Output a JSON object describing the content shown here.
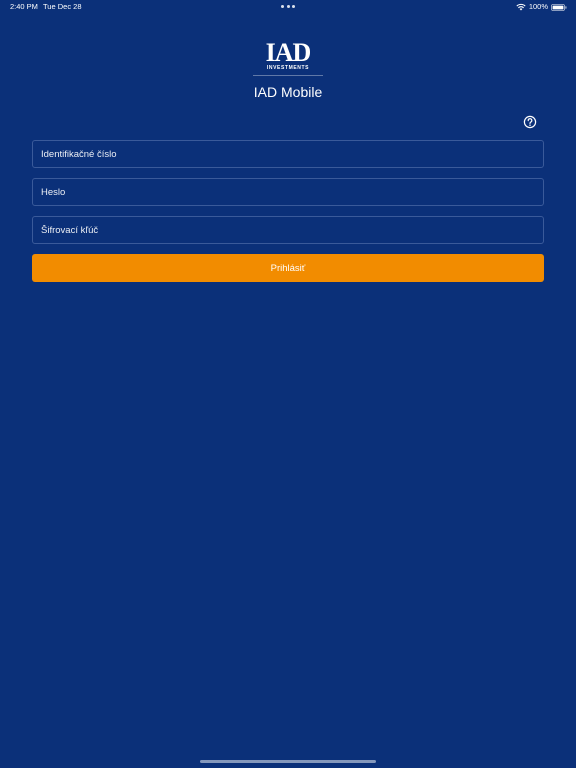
{
  "status_bar": {
    "time": "2:40 PM",
    "date": "Tue Dec 28",
    "battery": "100%"
  },
  "logo": {
    "mark": "IAD",
    "subtitle": "INVESTMENTS"
  },
  "app": {
    "title": "IAD Mobile"
  },
  "form": {
    "id_placeholder": "Identifikačné číslo",
    "password_placeholder": "Heslo",
    "key_placeholder": "Šifrovací kľúč",
    "login_label": "Prihlásiť"
  },
  "icons": {
    "help": "question-circle-icon",
    "wifi": "wifi-icon",
    "battery": "battery-icon"
  },
  "colors": {
    "background": "#0b3079",
    "field_border": "#3a5a9a",
    "accent": "#f28c00",
    "text": "#ffffff"
  }
}
